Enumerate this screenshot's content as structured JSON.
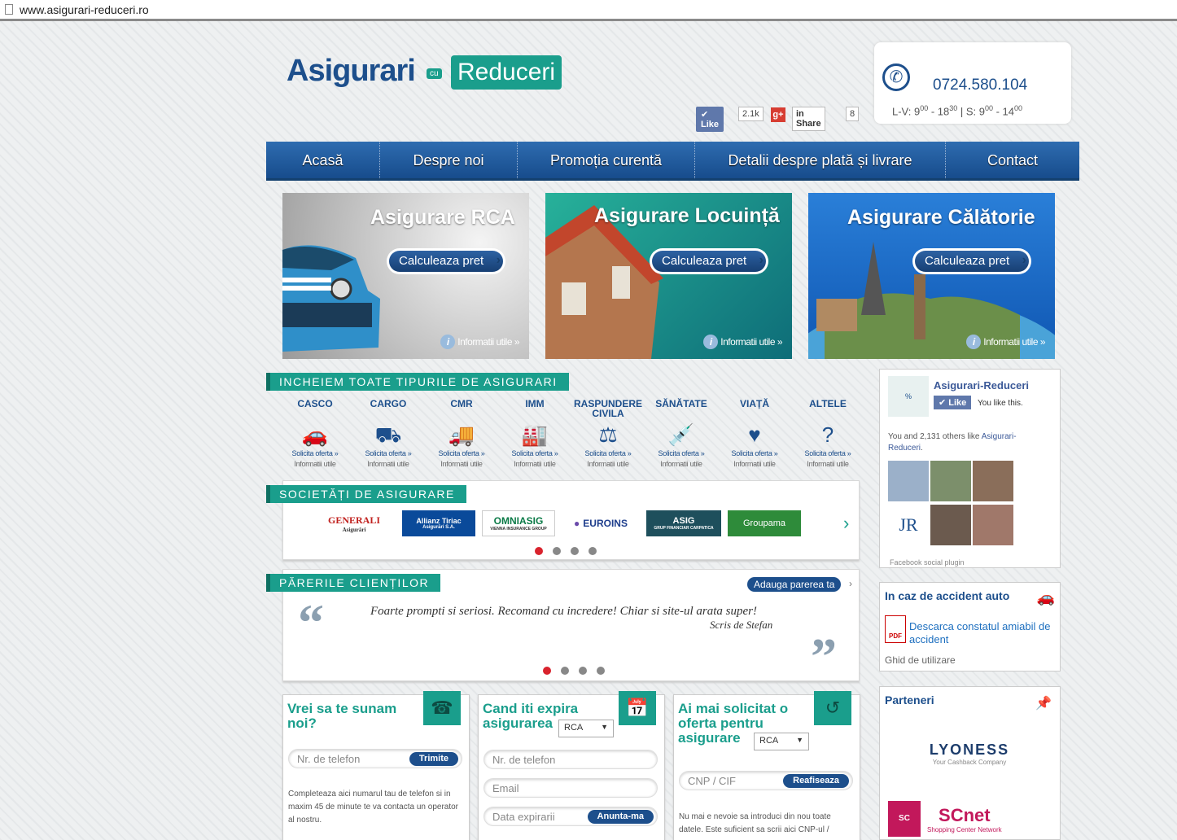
{
  "browser": {
    "url": "www.asigurari-reduceri.ro"
  },
  "logo": {
    "main": "Asigurari",
    "cu": "cu",
    "accent": "Reduceri"
  },
  "social": {
    "like_label": "Like",
    "like_count": "2.1k",
    "gplus": "g+",
    "share_label": "Share",
    "share_count": "8"
  },
  "contact": {
    "phone": "0724.580.104",
    "hours_prefix": "L-V: 9",
    "sup1": "00",
    "dash1": " - 18",
    "sup2": "30",
    "sat": " | S: 9",
    "sup3": "00",
    "dash2": " - 14",
    "sup4": "00"
  },
  "nav": [
    "Acasă",
    "Despre noi",
    "Promoția curentă",
    "Detalii despre plată și livrare",
    "Contact"
  ],
  "banners": [
    {
      "title": "Asigurare RCA",
      "button": "Calculeaza pret",
      "info": "Informatii utile »"
    },
    {
      "title": "Asigurare Locuință",
      "button": "Calculeaza pret",
      "info": "Informatii utile »"
    },
    {
      "title": "Asigurare Călătorie",
      "button": "Calculeaza pret",
      "info": "Informatii utile »"
    }
  ],
  "sections": {
    "types": "INCHEIEM TOATE TIPURILE DE ASIGURARI",
    "companies": "SOCIETĂȚI DE ASIGURARE",
    "reviews": "PĂRERILE CLIENȚILOR"
  },
  "insurance_types": [
    {
      "name": "CASCO",
      "icon": "🚗",
      "ask": "Solicita oferta »",
      "info": "Informatii utile"
    },
    {
      "name": "CARGO",
      "icon": "⛟",
      "ask": "Solicita oferta »",
      "info": "Informatii utile"
    },
    {
      "name": "CMR",
      "icon": "🚚",
      "ask": "Solicita oferta »",
      "info": "Informatii utile"
    },
    {
      "name": "IMM",
      "icon": "🏭",
      "ask": "Solicita oferta »",
      "info": "Informatii utile"
    },
    {
      "name": "RASPUNDERE CIVILA",
      "icon": "⚖",
      "ask": "Solicita oferta »",
      "info": "Informatii utile"
    },
    {
      "name": "SĂNĂTATE",
      "icon": "💉",
      "ask": "Solicita oferta »",
      "info": "Informatii utile"
    },
    {
      "name": "VIAȚĂ",
      "icon": "♥",
      "ask": "Solicita oferta »",
      "info": "Informatii utile"
    },
    {
      "name": "ALTELE",
      "icon": "?",
      "ask": "Solicita oferta »",
      "info": "Informatii utile"
    }
  ],
  "companies": [
    {
      "name": "GENERALI",
      "sub": "Asigurări"
    },
    {
      "name": "Allianz Tiriac",
      "sub": "Asigurări S.A."
    },
    {
      "name": "OMNIASIG",
      "sub": "VIENNA INSURANCE GROUP"
    },
    {
      "name": "EUROINS",
      "sub": ""
    },
    {
      "name": "ASIG",
      "sub": "GRUP FINANCIAR CARPATICA"
    },
    {
      "name": "Groupama",
      "sub": ""
    }
  ],
  "reviews": {
    "add_button": "Adauga parerea ta",
    "quote": "Foarte prompti si seriosi. Recomand cu incredere! Chiar si site-ul arata super!",
    "author": "Scris de Stefan"
  },
  "facebook": {
    "page": "Asigurari-Reduceri",
    "like": "Like",
    "you": "You like this.",
    "text_prefix": "You and 2,131 others like ",
    "text_link": "Asigurari-Reduceri",
    "text_suffix": ".",
    "plugin": "Facebook social plugin"
  },
  "accident": {
    "title": "In caz de accident auto",
    "link": "Descarca constatul amiabil de accident",
    "guide": "Ghid de utilizare"
  },
  "partners": {
    "title": "Parteneri",
    "p1": "LYONESS",
    "p1_sub": "Your Cashback Company",
    "p2": "SCnet",
    "p2_sub": "Shopping Center Network"
  },
  "forms": [
    {
      "title": "Vrei sa te sunam noi?",
      "icon": "☎",
      "phone_ph": "Nr. de telefon",
      "button": "Trimite",
      "note": "Completeaza aici numarul tau de telefon si in maxim 45 de minute te va contacta un operator al nostru."
    },
    {
      "title": "Cand iti expira asigurarea",
      "icon": "📅",
      "select": "RCA",
      "phone_ph": "Nr. de telefon",
      "email_ph": "Email",
      "date_ph": "Data expirarii",
      "button": "Anunta-ma"
    },
    {
      "title": "Ai mai solicitat o oferta pentru asigurare",
      "icon": "↺",
      "select": "RCA",
      "cnp_ph": "CNP / CIF",
      "button": "Reafiseaza",
      "note": "Nu mai e nevoie sa introduci din nou toate datele. Este suficient sa scrii aici CNP-ul /"
    }
  ],
  "colors": {
    "brand_blue": "#1d4f8c",
    "brand_teal": "#1a9e8c",
    "dot_active": "#d9232d"
  }
}
